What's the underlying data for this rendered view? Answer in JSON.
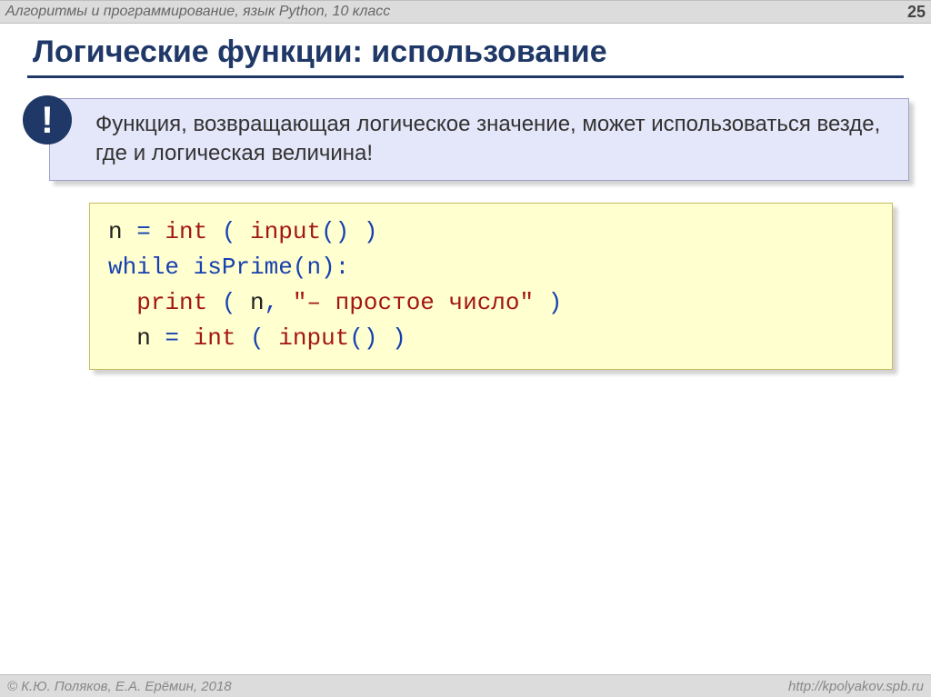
{
  "header": {
    "breadcrumb": "Алгоритмы и программирование, язык Python, 10 класс",
    "page_number": "25"
  },
  "title": "Логические функции: использование",
  "callout": {
    "icon_text": "!",
    "text": "Функция, возвращающая логическое значение, может использоваться везде, где и логическая величина!"
  },
  "code": {
    "line1": {
      "var": "n",
      "eq": " = ",
      "fn1": "int",
      "p1": " ( ",
      "fn2": "input",
      "p2": "() )"
    },
    "line2": {
      "kw": "while",
      "sp": " ",
      "fn": "isPrime",
      "p": "(n):"
    },
    "line3": {
      "indent": "  ",
      "fn": "print",
      "p1": " ( ",
      "var": "n",
      "c": ", ",
      "str": "\"– простое число\"",
      "p2": " )"
    },
    "line4": {
      "indent": "  ",
      "var": "n",
      "eq": " = ",
      "fn1": "int",
      "p1": " ( ",
      "fn2": "input",
      "p2": "() )"
    }
  },
  "footer": {
    "copyright": "© К.Ю. Поляков, Е.А. Ерёмин, 2018",
    "link": "http://kpolyakov.spb.ru"
  }
}
